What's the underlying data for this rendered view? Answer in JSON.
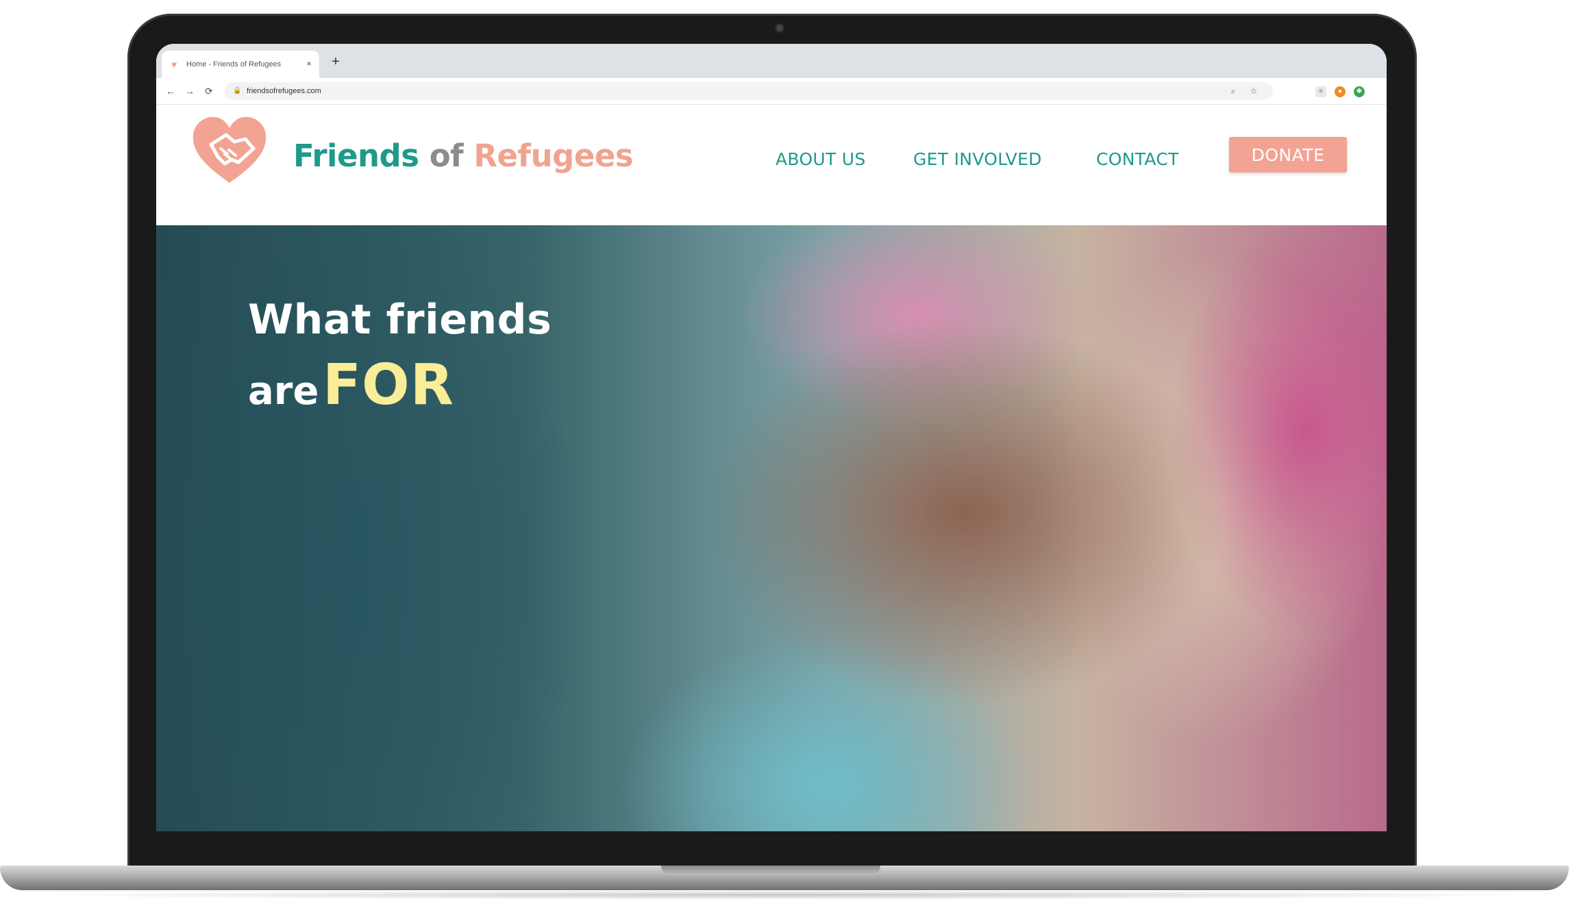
{
  "browser": {
    "tab_title": "Home - Friends of Refugees",
    "tab_close": "×",
    "new_tab": "+",
    "url": "friendsofrefugees.com",
    "nav": {
      "back": "←",
      "forward": "→",
      "reload": "⟳"
    }
  },
  "site": {
    "brand": {
      "friends": "Friends",
      "of": "of",
      "refugees": "Refugees"
    },
    "nav": {
      "about": "ABOUT US",
      "get_involved": "GET INVOLVED",
      "contact": "CONTACT",
      "donate": "DONATE"
    },
    "hero": {
      "line1": "What friends",
      "line2_prefix": "are",
      "line2_emphasis": "FOR"
    }
  },
  "colors": {
    "teal": "#1e9a8b",
    "salmon": "#f2a393",
    "gray": "#8c8c8c",
    "hero_yellow": "#faed98"
  },
  "icons": [
    "heart-handshake-icon",
    "lock-icon",
    "zoom-icon",
    "star-icon",
    "extension-icon"
  ]
}
